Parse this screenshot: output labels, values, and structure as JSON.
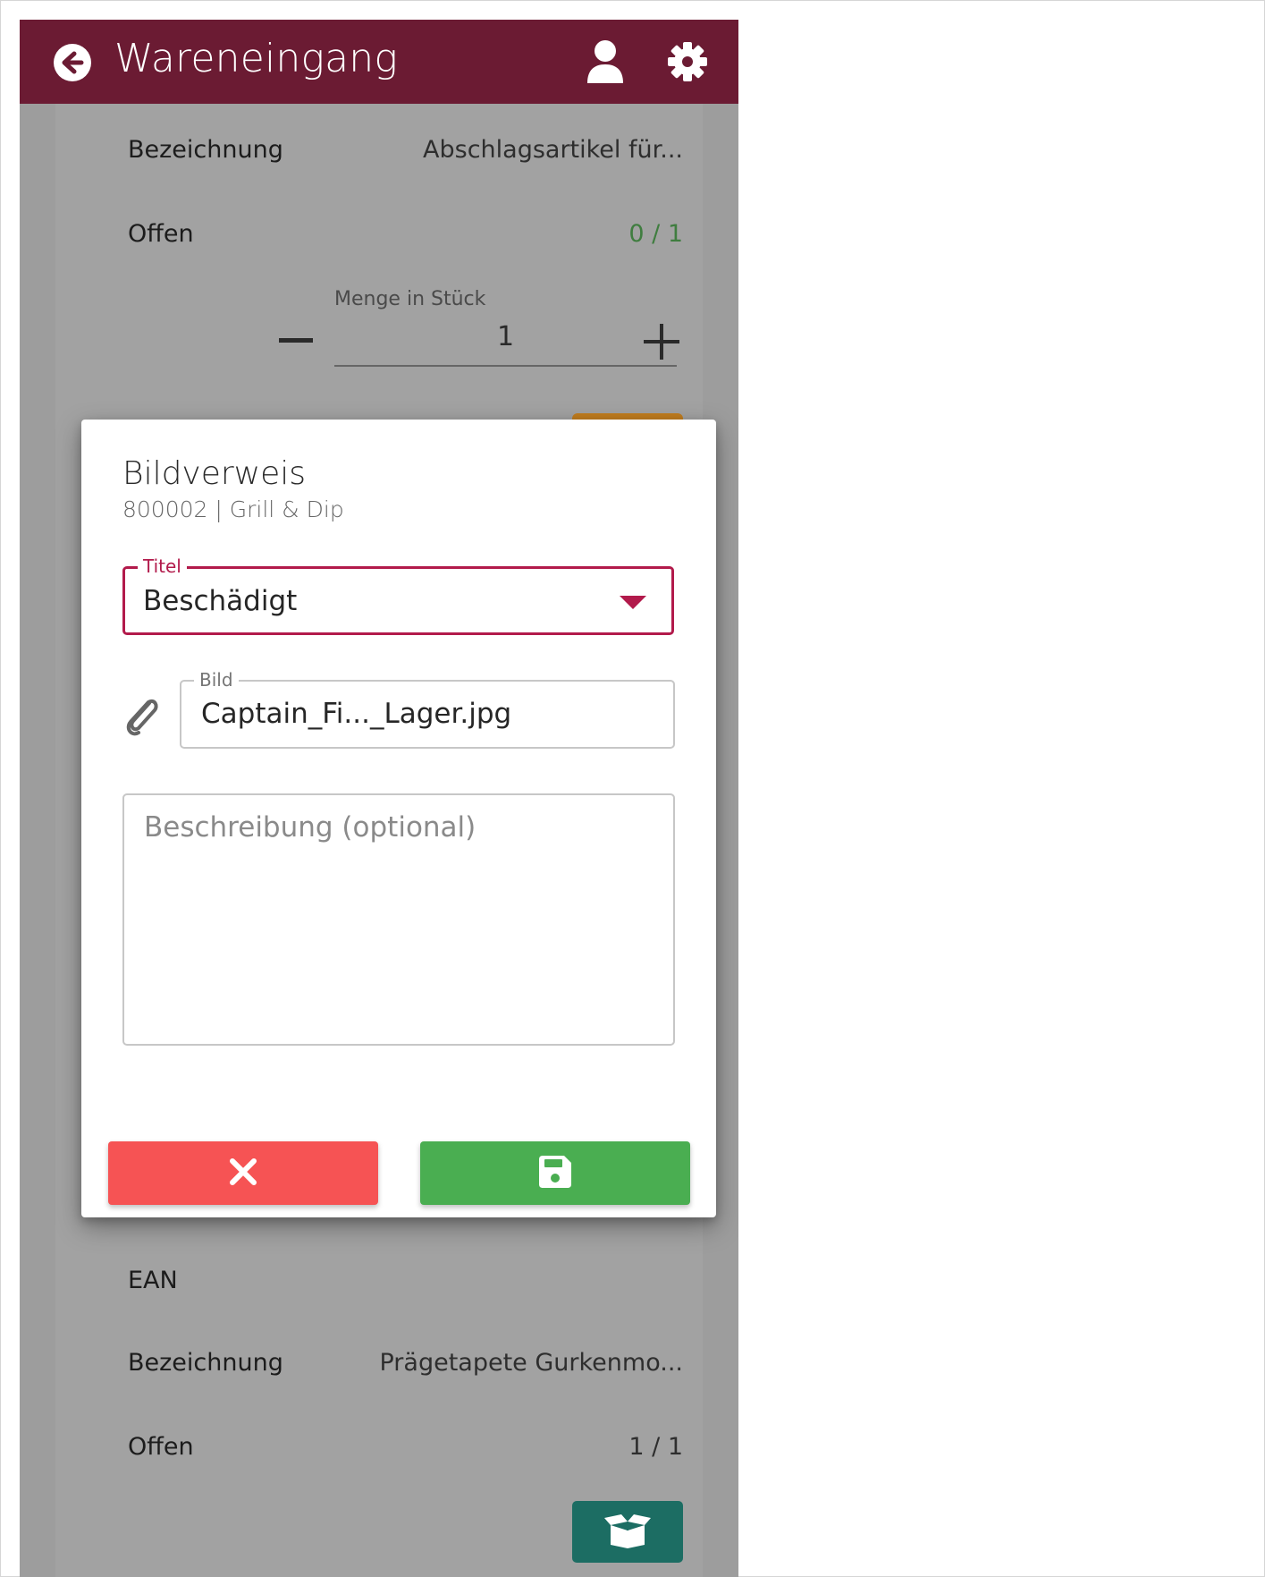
{
  "app": {
    "title": "Wareneingang",
    "accent_color": "#6b1b33",
    "icons": [
      "back-icon",
      "user-icon",
      "gear-icon"
    ]
  },
  "background_item_1": {
    "bezeichnung_label": "Bezeichnung",
    "bezeichnung_value": "Abschlagsartikel für...",
    "offen_label": "Offen",
    "offen_value": "0 / 1",
    "quantity_label": "Menge in Stück",
    "quantity_value": "1"
  },
  "background_item_2": {
    "ean_label": "EAN",
    "bezeichnung_label": "Bezeichnung",
    "bezeichnung_value": "Prägetapete Gurkenmo...",
    "offen_label": "Offen",
    "offen_value": "1 / 1",
    "box_button_icon": "open-box-icon"
  },
  "dialog": {
    "title": "Bildverweis",
    "subtitle": "800002 | Grill & Dip",
    "title_field": {
      "legend": "Titel",
      "value": "Beschädigt"
    },
    "image_field": {
      "legend": "Bild",
      "value": "Captain_Fi..._Lager.jpg"
    },
    "description_field": {
      "placeholder": "Beschreibung (optional)"
    },
    "cancel_color": "#f65354",
    "save_color": "#4aae51",
    "cancel_icon": "close-icon",
    "save_icon": "floppy-disk-icon"
  }
}
